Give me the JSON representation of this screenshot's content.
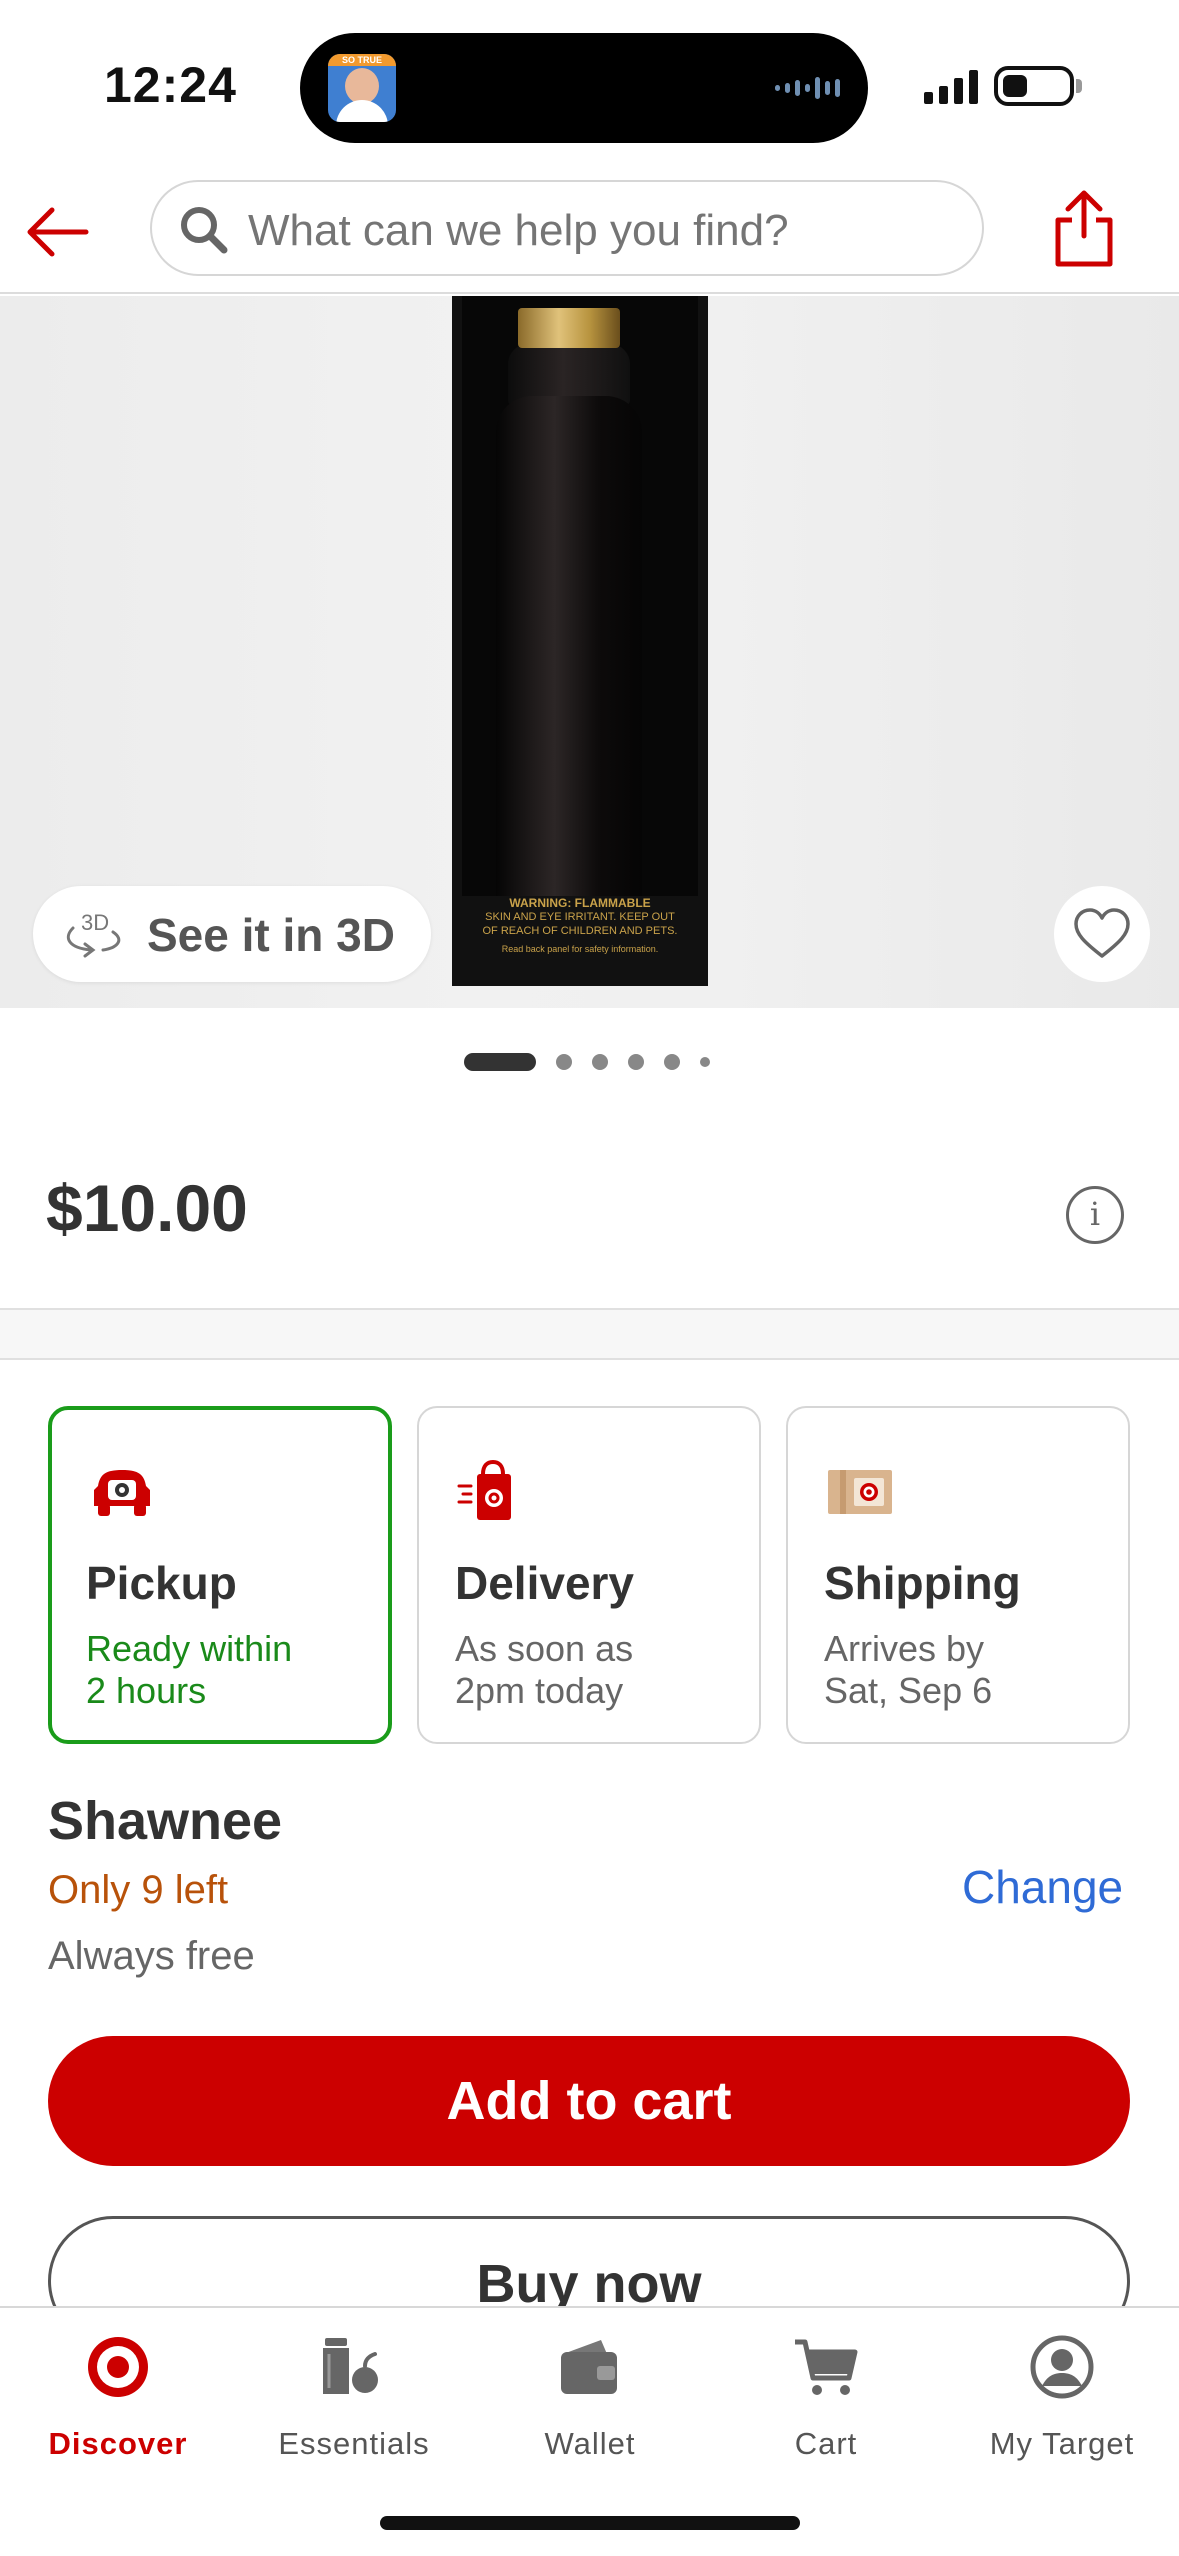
{
  "status_bar": {
    "time": "12:24",
    "island_avatar_tag": "SO TRUE"
  },
  "header": {
    "back_icon": "arrow-left-icon",
    "search_placeholder": "What can we help you find?",
    "share_icon": "share-icon"
  },
  "product_image": {
    "warning_line1": "WARNING: FLAMMABLE",
    "warning_line2": "SKIN AND EYE IRRITANT. KEEP OUT",
    "warning_line3": "OF REACH OF CHILDREN AND PETS.",
    "warning_line4": "Read back panel for safety information.",
    "see_3d_label": "See it in 3D",
    "favorite_icon": "heart-icon",
    "carousel_count": 6,
    "carousel_active": 0
  },
  "price": {
    "value": "$10.00",
    "info_icon": "info-icon"
  },
  "fulfillment": [
    {
      "title": "Pickup",
      "sub1": "Ready within",
      "sub2": "2 hours",
      "selected": true,
      "icon": "pickup-car-icon"
    },
    {
      "title": "Delivery",
      "sub1": "As soon as",
      "sub2": "2pm today",
      "selected": false,
      "icon": "delivery-bag-icon"
    },
    {
      "title": "Shipping",
      "sub1": "Arrives by",
      "sub2": "Sat, Sep 6",
      "selected": false,
      "icon": "shipping-box-icon"
    }
  ],
  "store": {
    "name": "Shawnee",
    "stock": "Only 9 left",
    "fee": "Always free",
    "change_label": "Change"
  },
  "actions": {
    "add_to_cart": "Add to cart",
    "buy_now": "Buy now"
  },
  "tabs": [
    {
      "label": "Discover",
      "icon": "target-bullseye-icon",
      "active": true
    },
    {
      "label": "Essentials",
      "icon": "essentials-icon",
      "active": false
    },
    {
      "label": "Wallet",
      "icon": "wallet-icon",
      "active": false
    },
    {
      "label": "Cart",
      "icon": "cart-icon",
      "active": false
    },
    {
      "label": "My Target",
      "icon": "account-icon",
      "active": false
    }
  ],
  "colors": {
    "brand_red": "#cc0000",
    "pickup_green": "#1a9c1a",
    "stock_orange": "#b8520a",
    "link_blue": "#2f6bd6"
  }
}
